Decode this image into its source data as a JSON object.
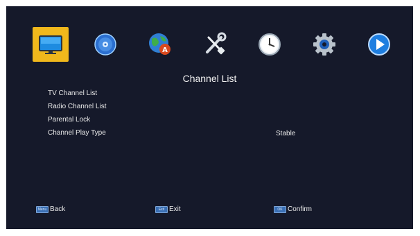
{
  "menu_bar": {
    "tiles": [
      {
        "icon": "tv-monitor-icon",
        "selected": true
      },
      {
        "icon": "disc-icon",
        "selected": false
      },
      {
        "icon": "globe-language-icon",
        "selected": false
      },
      {
        "icon": "tools-icon",
        "selected": false
      },
      {
        "icon": "clock-icon",
        "selected": false
      },
      {
        "icon": "gear-icon",
        "selected": false
      },
      {
        "icon": "play-icon",
        "selected": false
      }
    ]
  },
  "page": {
    "title": "Channel List"
  },
  "menu": {
    "items": [
      {
        "label": "TV Channel List"
      },
      {
        "label": "Radio Channel List"
      },
      {
        "label": "Parental Lock"
      },
      {
        "label": "Channel Play Type",
        "value": "Stable"
      }
    ]
  },
  "footer": {
    "back": {
      "key": "Menu",
      "label": "Back"
    },
    "exit": {
      "key": "Exit",
      "label": "Exit"
    },
    "confirm": {
      "key": "OK",
      "label": "Confirm"
    }
  },
  "colors": {
    "background": "#15192a",
    "selected_tile": "#f0b81c",
    "text": "#e9e9e9",
    "key_badge": "#3a6fb4"
  }
}
